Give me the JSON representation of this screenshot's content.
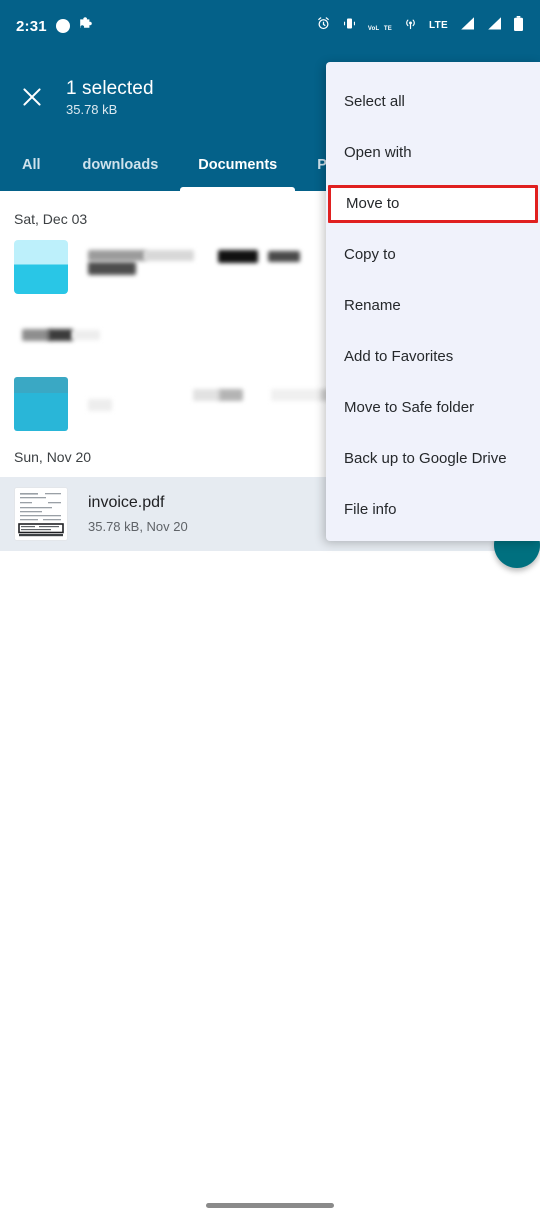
{
  "theme": {
    "appbar_color": "#046189",
    "menu_bg": "#f0f2fb",
    "highlight_border": "#e02020",
    "selected_row_bg": "#e6ebf1",
    "fab_color": "#00707f",
    "accent_thumb": "#29b6d8"
  },
  "status_bar": {
    "time": "2:31",
    "left_icons": [
      "circle-icon",
      "puzzle-piece-icon"
    ],
    "right_icons": [
      "alarm-icon",
      "vibrate-icon",
      "volte-icon",
      "hotspot-icon",
      "lte-icon",
      "signal-bars-icon",
      "signal-bars-2-icon",
      "battery-icon"
    ],
    "volte_label_top": "VoL",
    "volte_label_bottom": "TE",
    "lte_label": "LTE"
  },
  "app_bar": {
    "close_icon": "close-icon",
    "selection_title": "1 selected",
    "selection_size": "35.78 kB"
  },
  "tabs": [
    {
      "label": "All",
      "active": false
    },
    {
      "label": "downloads",
      "active": false
    },
    {
      "label": "Documents",
      "active": true
    },
    {
      "label": "Private",
      "active": false
    }
  ],
  "list": {
    "groups": [
      {
        "date": "Sat, Dec 03",
        "items": [
          {
            "name": "",
            "meta": "",
            "redacted": true,
            "thumb": "image-thumb",
            "selected": false
          },
          {
            "name": "",
            "meta": "",
            "redacted": true,
            "thumb": "none",
            "selected": false
          },
          {
            "name": "",
            "meta": "",
            "redacted": true,
            "thumb": "image-thumb",
            "selected": false
          }
        ]
      },
      {
        "date": "Sun, Nov 20",
        "items": [
          {
            "name": "invoice.pdf",
            "meta": "35.78 kB, Nov 20",
            "redacted": false,
            "thumb": "pdf-document-thumb",
            "selected": true
          }
        ]
      }
    ]
  },
  "fab": {
    "name": "add-fab",
    "label": ""
  },
  "menu": {
    "items": [
      {
        "label": "Select all",
        "highlighted": false
      },
      {
        "label": "Open with",
        "highlighted": false
      },
      {
        "label": "Move to",
        "highlighted": true
      },
      {
        "label": "Copy to",
        "highlighted": false
      },
      {
        "label": "Rename",
        "highlighted": false
      },
      {
        "label": "Add to Favorites",
        "highlighted": false
      },
      {
        "label": "Move to Safe folder",
        "highlighted": false
      },
      {
        "label": "Back up to Google Drive",
        "highlighted": false
      },
      {
        "label": "File info",
        "highlighted": false
      }
    ]
  },
  "nav_bar": {
    "handle": "gesture-handle"
  }
}
